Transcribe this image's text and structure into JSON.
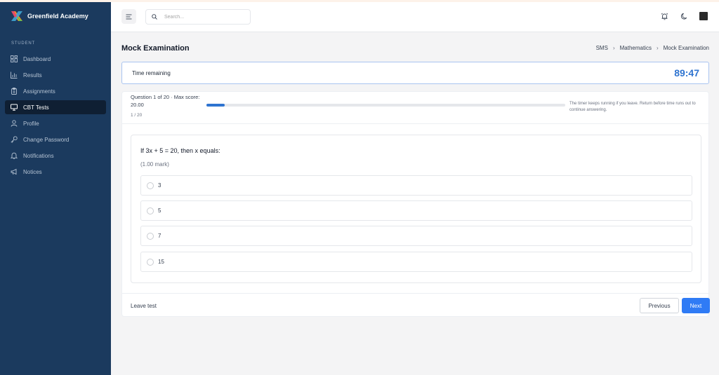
{
  "brand": {
    "name": "Greenfield Academy"
  },
  "sidebar": {
    "section": "STUDENT",
    "items": [
      {
        "label": "Dashboard",
        "icon": "dashboard-icon"
      },
      {
        "label": "Results",
        "icon": "bar-chart-icon"
      },
      {
        "label": "Assignments",
        "icon": "clipboard-icon"
      },
      {
        "label": "CBT Tests",
        "icon": "monitor-icon",
        "active": true
      },
      {
        "label": "Profile",
        "icon": "user-icon"
      },
      {
        "label": "Change Password",
        "icon": "key-icon"
      },
      {
        "label": "Notifications",
        "icon": "bell-icon"
      },
      {
        "label": "Notices",
        "icon": "megaphone-icon"
      }
    ]
  },
  "header": {
    "search_placeholder": "Search...",
    "icons": [
      "alarm-icon",
      "moon-icon",
      "avatar"
    ]
  },
  "page": {
    "title": "Mock Examination",
    "breadcrumb": [
      "SMS",
      "Mathematics",
      "Mock Examination"
    ]
  },
  "timer": {
    "label": "Time remaining",
    "value": "89:47"
  },
  "progress": {
    "meta": "Question 1 of 20 · Max score: 20.00",
    "count": "1 / 20",
    "fraction": 0.05,
    "notice": "The timer keeps running if you leave. Return before time runs out to continue answering."
  },
  "question": {
    "text": "If 3x + 5 = 20, then x equals:",
    "mark": "(1.00 mark)",
    "options": [
      "3",
      "5",
      "7",
      "15"
    ]
  },
  "footer": {
    "leave": "Leave test",
    "previous": "Previous",
    "next": "Next"
  },
  "colors": {
    "sidebar": "#1b3a5e",
    "accent": "#2f74d0",
    "primary_button": "#2f7bf5"
  }
}
